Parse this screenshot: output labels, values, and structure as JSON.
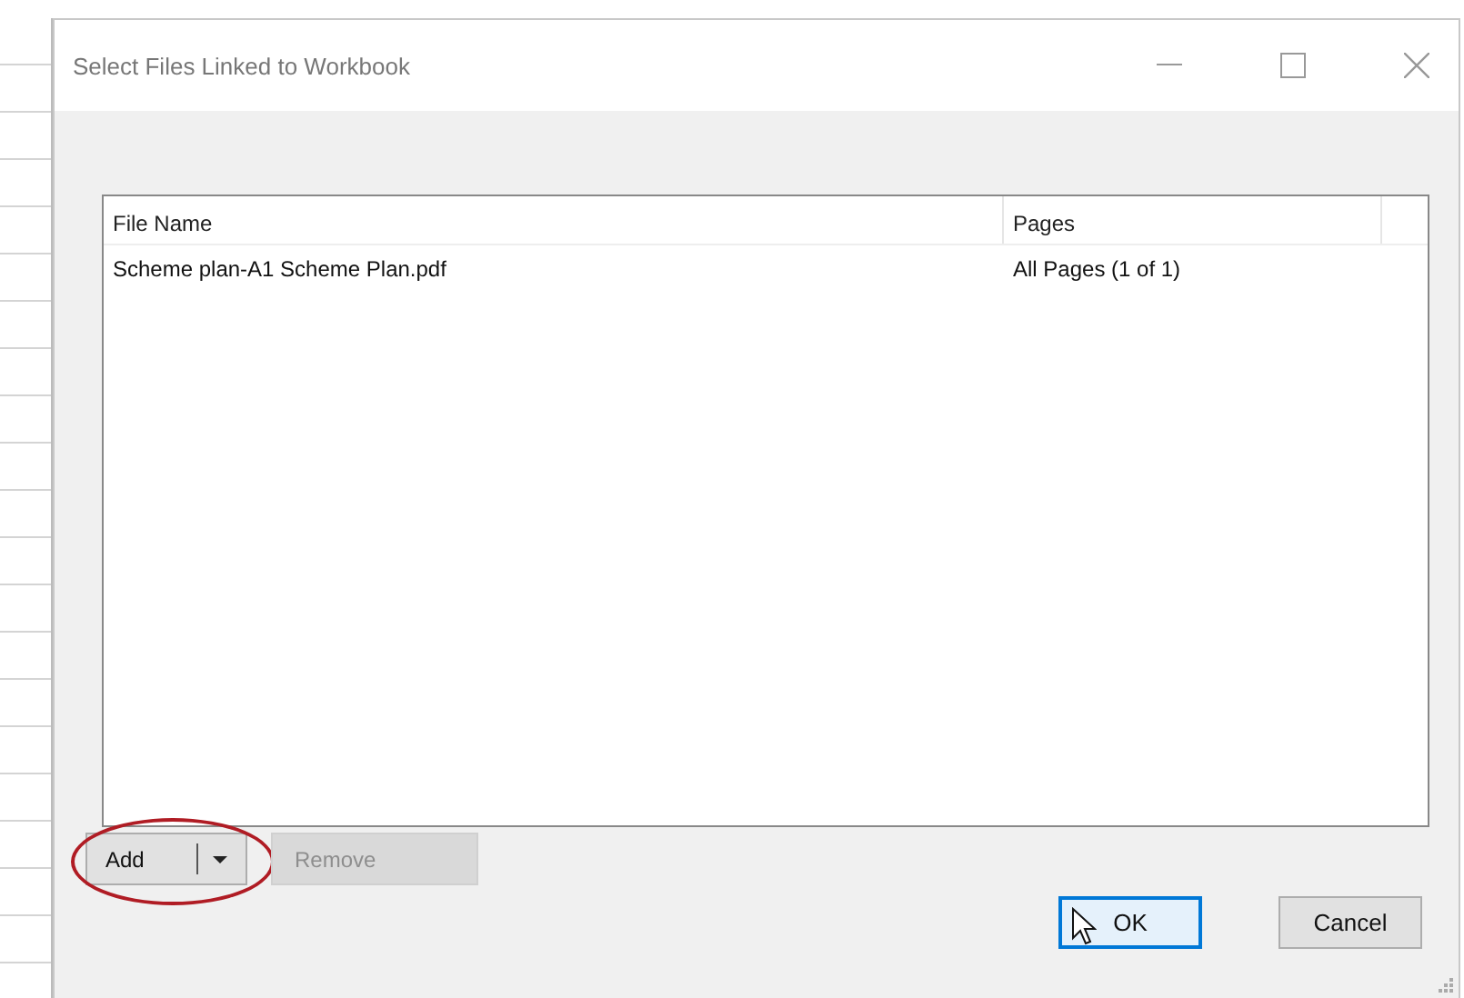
{
  "window": {
    "title": "Select Files Linked to Workbook"
  },
  "table": {
    "columns": [
      "File Name",
      "Pages"
    ],
    "rows": [
      [
        "Scheme plan-A1 Scheme Plan.pdf",
        "All Pages (1 of 1)"
      ]
    ]
  },
  "list_buttons": [
    {
      "label": "Add",
      "kind": "split",
      "disabled": false,
      "highlighted": true
    },
    {
      "label": "Remove",
      "kind": "plain",
      "disabled": true,
      "highlighted": false
    }
  ],
  "dialog_buttons": [
    {
      "label": "OK",
      "default": true,
      "pointer": true
    },
    {
      "label": "Cancel",
      "default": false,
      "pointer": false
    }
  ]
}
